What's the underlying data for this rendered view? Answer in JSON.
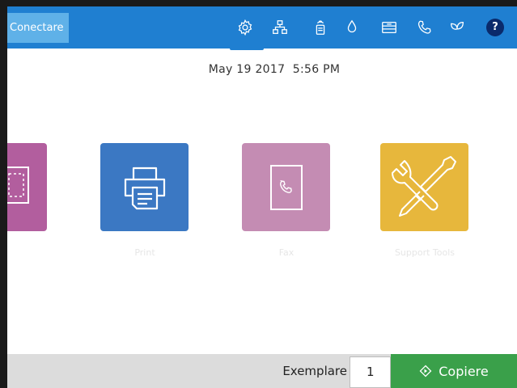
{
  "topbar": {
    "connect_label": "Conectare",
    "icons": [
      "gear-icon",
      "network-icon",
      "wireless-icon",
      "droplet-icon",
      "tray-icon",
      "phone-icon",
      "leaf-icon",
      "help-icon"
    ],
    "help_glyph": "?",
    "bar_color": "#1f7fd1"
  },
  "header": {
    "datetime": "May 19 2017  5:56 PM"
  },
  "apps": [
    {
      "label": "",
      "color": "#b25e9e",
      "icon": "scan-icon"
    },
    {
      "label": "Print",
      "color": "#3b78c3",
      "icon": "printer-icon"
    },
    {
      "label": "Fax",
      "color": "#c48cb3",
      "icon": "fax-icon"
    },
    {
      "label": "Support Tools",
      "color": "#e7b73c",
      "icon": "tools-icon"
    }
  ],
  "bottombar": {
    "copies_label": "Exemplare",
    "copies_value": "1",
    "copy_button_label": "Copiere",
    "copy_button_color": "#3aa04a"
  }
}
